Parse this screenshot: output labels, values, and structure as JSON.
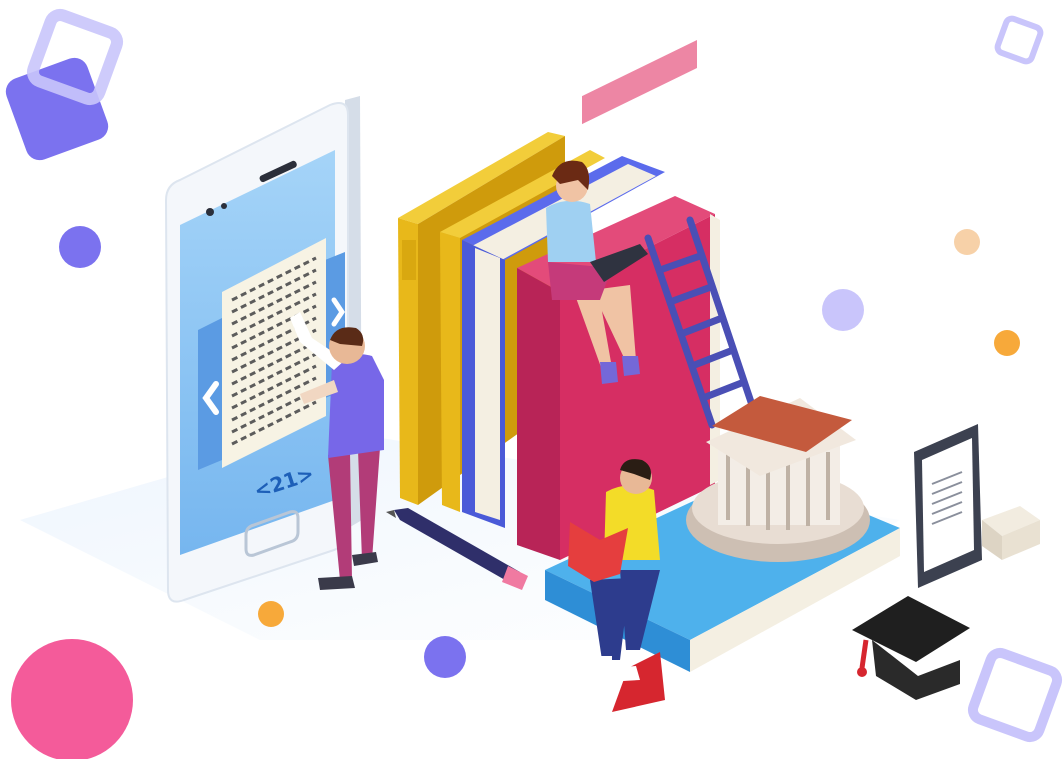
{
  "illustration": {
    "phone_page_number": "<21>",
    "icons": {
      "left_arrow": "chevron-left-icon",
      "right_arrow": "chevron-right-icon",
      "grad_cap": "graduation-cap-icon"
    },
    "colors": {
      "yellow_book": "#e8b81a",
      "blue_book": "#4a5ad8",
      "cream_book": "#f4efe2",
      "red_book": "#d62e63",
      "phone_screen": "#8fc8f5",
      "phone_body": "#f4f7fb",
      "pink_dot": "#f45b9a",
      "purple_dot": "#7b72ef",
      "orange_dot": "#f7a93a",
      "lavender": "#c9c5fb",
      "ladder": "#4a4fb5",
      "temple_roof": "#c45a3d",
      "base_book": "#4eb1ec"
    }
  }
}
